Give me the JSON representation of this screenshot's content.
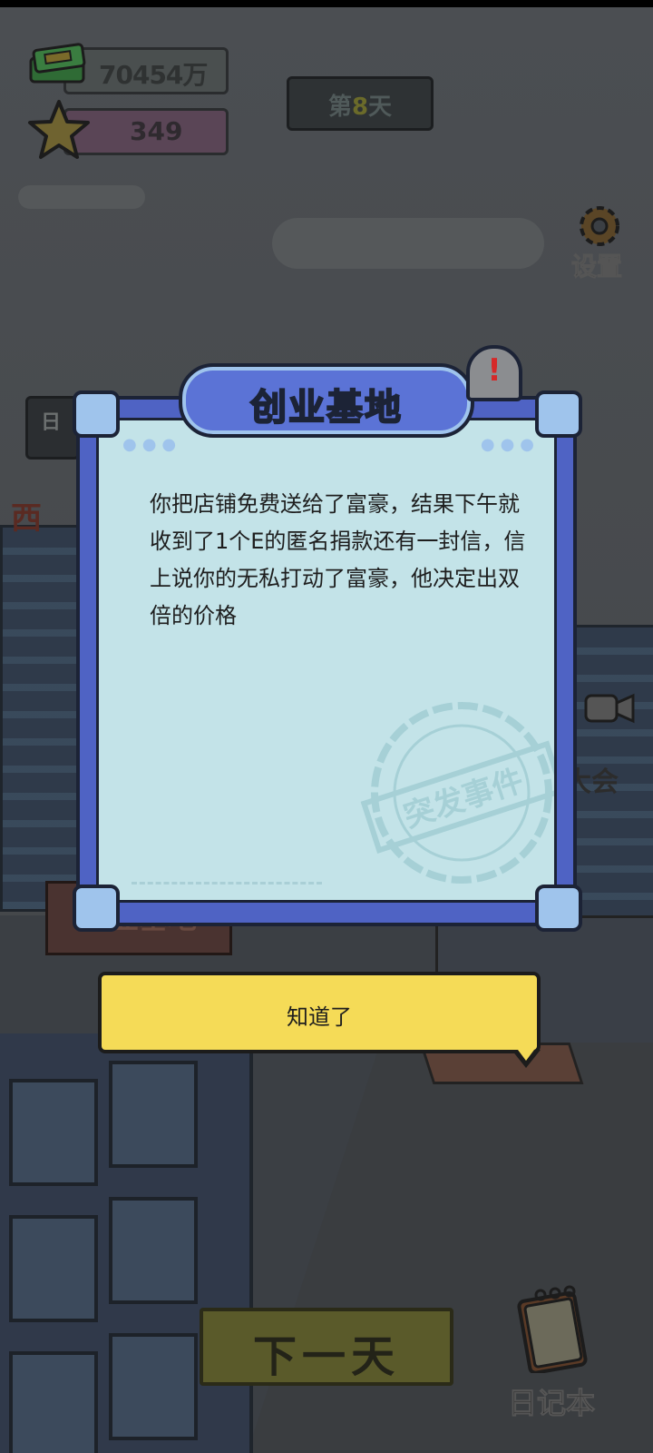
{
  "hud": {
    "money": "70454万",
    "stars": "349",
    "day_prefix": "第",
    "day_number": "8",
    "day_suffix": "天",
    "settings_label": "设置"
  },
  "background": {
    "left_panel_text": "日",
    "left_sign_text": "西",
    "conference_label": "大会",
    "board_sign_text": "创业基地"
  },
  "dialog": {
    "title": "创业基地",
    "alert_mark": "!",
    "message": "你把店铺免费送给了富豪，结果下午就收到了1个E的匿名捐款还有一封信，信上说你的无私打动了富豪，他决定出双倍的价格",
    "stamp_text": "突发事件",
    "ok_label": "知道了"
  },
  "footer": {
    "next_day_label": "下一天",
    "diary_label": "日记本"
  },
  "colors": {
    "dialog_frame": "#4f63c4",
    "dialog_inner": "#c3e3e8",
    "ok_button": "#f5db57",
    "alert_red": "#d52929"
  }
}
